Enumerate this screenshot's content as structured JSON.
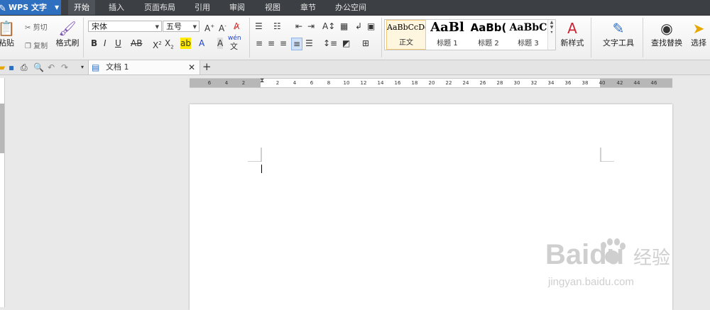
{
  "app": {
    "title": "WPS 文字"
  },
  "menu": {
    "items": [
      "开始",
      "插入",
      "页面布局",
      "引用",
      "审阅",
      "视图",
      "章节",
      "办公空间"
    ],
    "active": "开始"
  },
  "clipboard": {
    "paste": "粘贴",
    "cut": "剪切",
    "copy": "复制",
    "format_painter": "格式刷"
  },
  "font": {
    "family": "宋体",
    "size": "五号",
    "pinyin": "wén"
  },
  "styles": [
    {
      "preview": "AaBbCcDd",
      "name": "正文"
    },
    {
      "preview": "AaBl",
      "name": "标题 1"
    },
    {
      "preview": "AaBb(",
      "name": "标题 2"
    },
    {
      "preview": "AaBbC",
      "name": "标题 3"
    }
  ],
  "ribbon": {
    "new_style": "新样式",
    "text_tools": "文字工具",
    "find_replace": "查找替换",
    "select": "选择"
  },
  "doc_tab": {
    "name": "文档 1"
  },
  "ruler": {
    "left_ticks": [
      "6",
      "4",
      "2"
    ],
    "ticks": [
      "2",
      "4",
      "6",
      "8",
      "10",
      "12",
      "14",
      "16",
      "18",
      "20",
      "22",
      "24",
      "26",
      "28",
      "30",
      "32",
      "34",
      "36",
      "38",
      "40",
      "42",
      "44",
      "46"
    ]
  },
  "watermark": {
    "brand": "Baidu",
    "product": "经验",
    "url": "jingyan.baidu.com"
  },
  "colors": {
    "menubar": "#3c3f44",
    "app_button": "#2f6fc0",
    "ribbon": "#f4f4f4",
    "watermark": "#cfcfcf"
  }
}
